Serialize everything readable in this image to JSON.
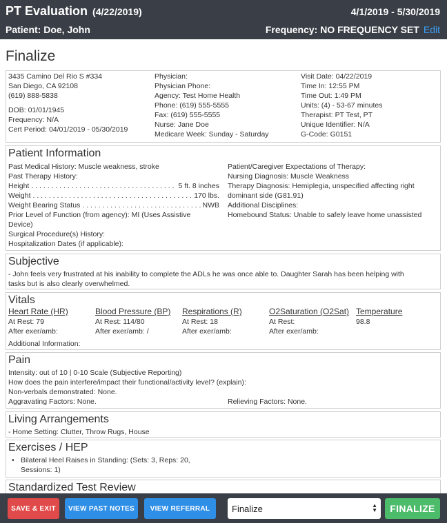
{
  "header": {
    "title": "PT Evaluation",
    "title_date": "(4/22/2019)",
    "date_range": "4/1/2019 - 5/30/2019",
    "patient": "Patient: Doe, John",
    "frequency": "Frequency: NO FREQUENCY SET",
    "edit_label": "Edit"
  },
  "page_title": "Finalize",
  "info": {
    "col1": [
      "3435 Camino Del Rio S #334",
      "San Diego, CA 92108",
      "(619) 888-5838",
      "DOB: 01/01/1945",
      "Frequency: N/A",
      "Cert Period: 04/01/2019 - 05/30/2019"
    ],
    "col2": [
      "Physician:",
      "Physician Phone:",
      "Agency: Test Home Health",
      "Phone: (619) 555-5555",
      "Fax: (619) 555-5555",
      "Nurse: Jane Doe",
      "Medicare Week: Sunday - Saturday"
    ],
    "col3": [
      "Visit Date: 04/22/2019",
      "Time In: 12:55 PM",
      "Time Out: 1:49 PM",
      "Units: (4) - 53-67 minutes",
      "Therapist: PT Test, PT",
      "Unique Identifier: N/A",
      "G-Code: G0151"
    ]
  },
  "patient_info": {
    "title": "Patient Information",
    "left": {
      "pmh": "Past Medical History: Muscle weakness, stroke",
      "pth": "Past Therapy History:",
      "height_label": "Height",
      "height_value": "5 ft. 8 inches",
      "weight_label": "Weight",
      "weight_value": "170 lbs.",
      "wb_label": "Weight Bearing Status",
      "wb_value": "NWB",
      "plof_1": "Prior Level of Function (from agency): MI (Uses Assistive",
      "plof_2": "Device)",
      "surg": "Surgical Procedure(s) History:",
      "hosp": "Hospitalization Dates (if applicable):"
    },
    "right": {
      "expect": "Patient/Caregiver Expectations of Therapy:",
      "nursing": "Nursing Diagnosis: Muscle Weakness",
      "therapy_1": "Therapy Diagnosis: Hemiplegia, unspecified affecting right",
      "therapy_2": "dominant side (G81.91)",
      "disciplines": "Additional Disciplines:",
      "homebound": "Homebound Status: Unable to safely leave home unassisted"
    }
  },
  "subjective": {
    "title": "Subjective",
    "line1": "- John feels very frustrated at his inability to complete the ADLs he was once able to. Daughter Sarah has been helping with",
    "line2": "tasks but is also clearly overwhelmed."
  },
  "vitals": {
    "title": "Vitals",
    "columns": [
      {
        "header": "Heart Rate (HR)",
        "rest": "At Rest: 79",
        "after": "After exer/amb:"
      },
      {
        "header": "Blood Pressure (BP)",
        "rest": "At Rest: 114/80",
        "after": "After exer/amb: /"
      },
      {
        "header": "Respirations (R)",
        "rest": "At Rest: 18",
        "after": "After exer/amb:"
      },
      {
        "header": "O2Saturation (O2Sat)",
        "rest": "At Rest:",
        "after": "After exer/amb:"
      },
      {
        "header": "Temperature",
        "rest": "98.8",
        "after": ""
      }
    ],
    "additional": "Additional Information:"
  },
  "pain": {
    "title": "Pain",
    "intensity": "Intensity: out of 10 | 0-10 Scale (Subjective Reporting)",
    "interfere": "How does the pain interfere/impact their functional/activity level? (explain):",
    "nonverbals": "Non-verbals demonstrated: None.",
    "aggravating": "Aggravating Factors: None.",
    "relieving": "Relieving Factors: None."
  },
  "living": {
    "title": "Living Arrangements",
    "setting": "- Home Setting: Clutter, Throw Rugs, House"
  },
  "exercises": {
    "title": "Exercises / HEP",
    "item_1": "Bilateral Heel Raises in Standing: (Sets: 3, Reps: 20,",
    "item_2": "Sessions: 1)"
  },
  "standardized": {
    "title": "Standardized Test Review"
  },
  "footer": {
    "save_exit": "SAVE & EXIT",
    "view_past_notes": "VIEW PAST NOTES",
    "view_referral": "VIEW REFERRAL",
    "select_value": "Finalize",
    "finalize": "FINALIZE"
  }
}
